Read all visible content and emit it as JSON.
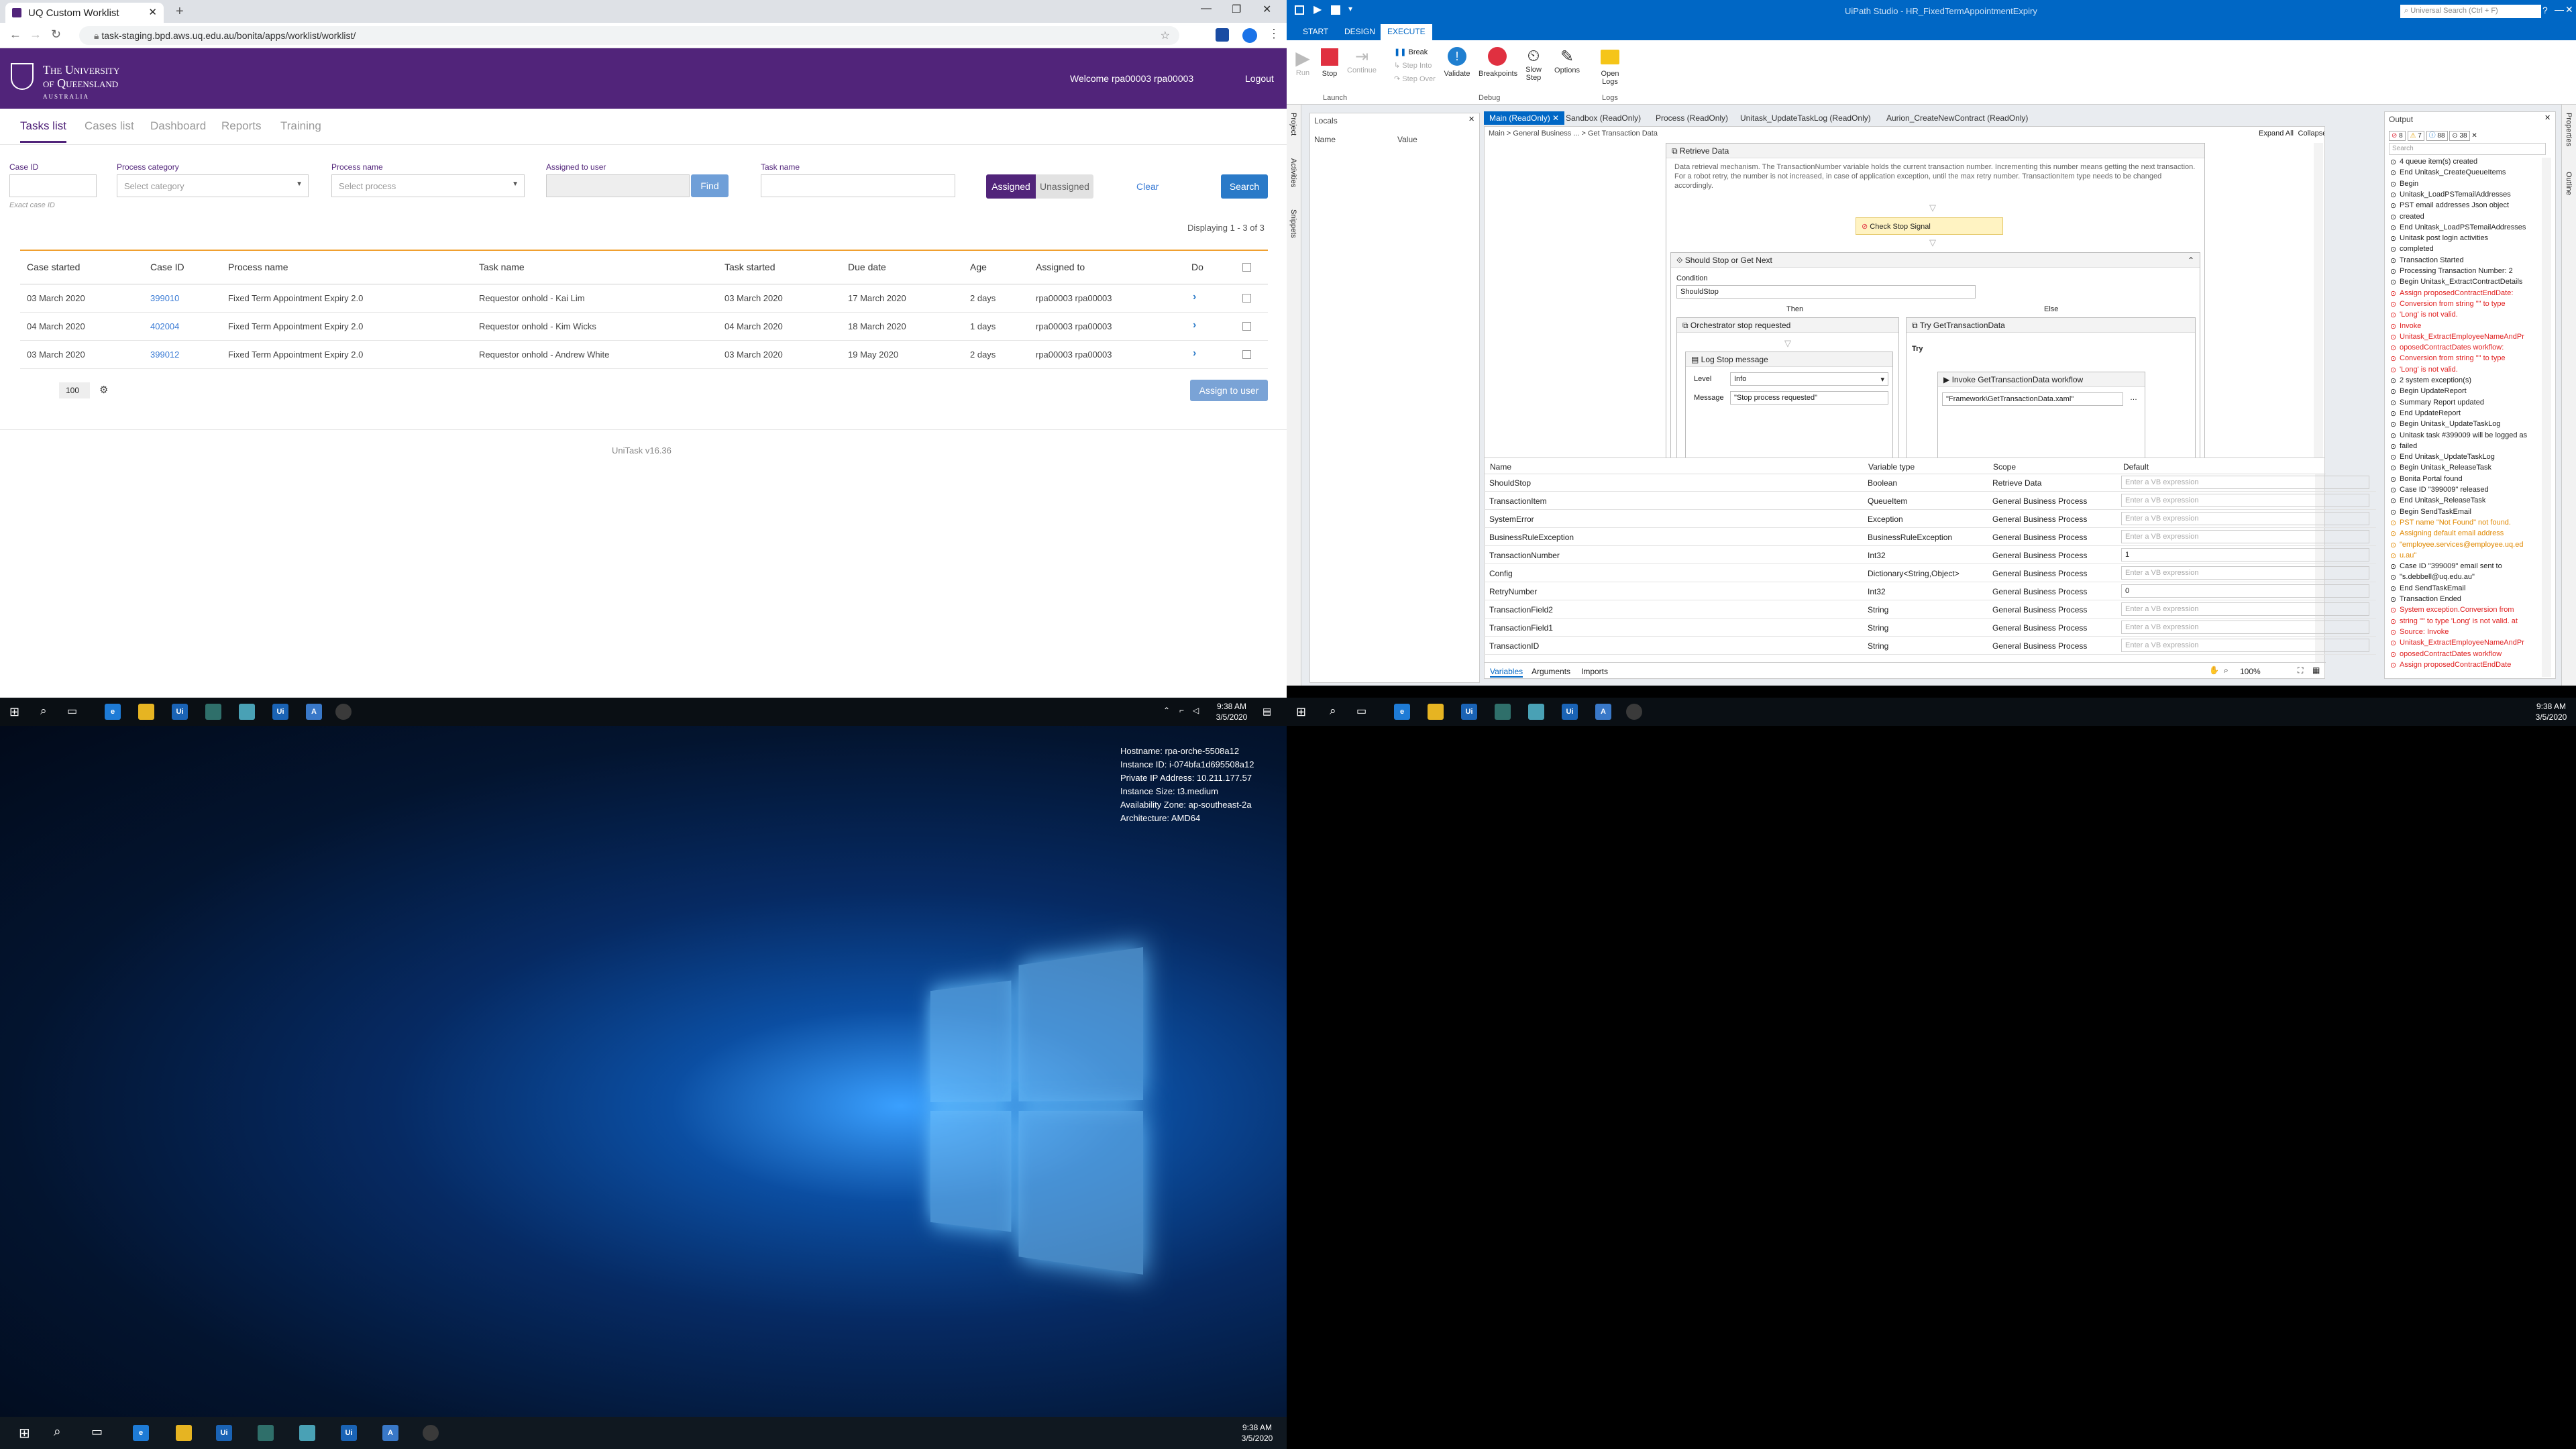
{
  "browser": {
    "tab_title": "UQ Custom Worklist",
    "url": "task-staging.bpd.aws.uq.edu.au/bonita/apps/worklist/worklist/"
  },
  "uq": {
    "logo_line1": "The University",
    "logo_line2": "of Queensland",
    "logo_line3": "AUSTRALIA",
    "welcome": "Welcome rpa00003 rpa00003",
    "logout": "Logout",
    "nav": [
      "Tasks list",
      "Cases list",
      "Dashboard",
      "Reports",
      "Training"
    ],
    "filters": {
      "case_id_label": "Case ID",
      "case_id_hint": "Exact case ID",
      "category_label": "Process category",
      "category_placeholder": "Select category",
      "process_label": "Process name",
      "process_placeholder": "Select process",
      "assigned_label": "Assigned to user",
      "find": "Find",
      "task_label": "Task name",
      "assigned": "Assigned",
      "unassigned": "Unassigned",
      "clear": "Clear",
      "search": "Search"
    },
    "displaying": "Displaying 1 - 3 of 3",
    "columns": [
      "Case started",
      "Case ID",
      "Process name",
      "Task name",
      "Task started",
      "Due date",
      "Age",
      "Assigned to",
      "Do"
    ],
    "rows": [
      {
        "case_started": "03 March 2020",
        "case_id": "399010",
        "process": "Fixed Term Appointment Expiry 2.0",
        "task": "Requestor onhold - Kai Lim",
        "task_started": "03 March 2020",
        "due": "17 March 2020",
        "age": "2 days",
        "assigned": "rpa00003 rpa00003"
      },
      {
        "case_started": "04 March 2020",
        "case_id": "402004",
        "process": "Fixed Term Appointment Expiry 2.0",
        "task": "Requestor onhold - Kim Wicks",
        "task_started": "04 March 2020",
        "due": "18 March 2020",
        "age": "1 days",
        "assigned": "rpa00003 rpa00003"
      },
      {
        "case_started": "03 March 2020",
        "case_id": "399012",
        "process": "Fixed Term Appointment Expiry 2.0",
        "task": "Requestor onhold - Andrew White",
        "task_started": "03 March 2020",
        "due": "19 May 2020",
        "age": "2 days",
        "assigned": "rpa00003 rpa00003"
      }
    ],
    "page_size": "100",
    "assign_btn": "Assign to user",
    "footer": "UniTask v16.36",
    "accent": "#51247a"
  },
  "uipath": {
    "title": "UiPath Studio - HR_FixedTermAppointmentExpiry",
    "search_placeholder": "Universal Search (Ctrl + F)",
    "ribbon_tabs": [
      "START",
      "DESIGN",
      "EXECUTE"
    ],
    "ribbon_buttons": [
      "Run",
      "Stop",
      "Continue",
      "Validate",
      "Breakpoints",
      "Slow Step",
      "Options",
      "Open Logs"
    ],
    "step_buttons": [
      "Break",
      "Step Into",
      "Step Over"
    ],
    "groups": [
      "Launch",
      "Debug",
      "Logs"
    ],
    "left_rail": [
      "Project",
      "Activities",
      "Snippets"
    ],
    "right_rail": [
      "Properties",
      "Outline"
    ],
    "locals": {
      "title": "Locals",
      "name": "Name",
      "value": "Value"
    },
    "doc_tabs": [
      "Main (ReadOnly)",
      "Sandbox (ReadOnly)",
      "Process (ReadOnly)",
      "Unitask_UpdateTaskLog (ReadOnly)",
      "Aurion_CreateNewContract (ReadOnly)"
    ],
    "breadcrumb": [
      "Main",
      "General Business ...",
      "Get Transaction Data"
    ],
    "expand_all": "Expand All",
    "collapse_all": "Collapse All",
    "designer": {
      "retrieve_data": "Retrieve Data",
      "retrieve_desc": "Data retrieval mechanism. The TransactionNumber variable holds the current transaction number. Incrementing this number means getting the next transaction. For a robot retry, the number is not increased, in case of application exception, until the max retry number. TransactionItem type needs to be changed accordingly.",
      "check_stop": "Check Stop Signal",
      "should_stop": "Should Stop or Get Next",
      "condition": "Condition",
      "condition_value": "ShouldStop",
      "then": "Then",
      "else": "Else",
      "orch_stop": "Orchestrator stop requested",
      "try_get": "Try GetTransactionData",
      "try": "Try",
      "log_stop": "Log Stop message",
      "level": "Level",
      "level_value": "Info",
      "message": "Message",
      "message_value": "\"Stop process requested\"",
      "invoke": "Invoke GetTransactionData workflow",
      "invoke_path": "\"Framework\\GetTransactionData.xaml\""
    },
    "variables": {
      "headers": [
        "Name",
        "Variable type",
        "Scope",
        "Default"
      ],
      "default_placeholder": "Enter a VB expression",
      "rows": [
        {
          "name": "ShouldStop",
          "type": "Boolean",
          "scope": "Retrieve Data",
          "default": ""
        },
        {
          "name": "TransactionItem",
          "type": "QueueItem",
          "scope": "General Business Process",
          "default": ""
        },
        {
          "name": "SystemError",
          "type": "Exception",
          "scope": "General Business Process",
          "default": ""
        },
        {
          "name": "BusinessRuleException",
          "type": "BusinessRuleException",
          "scope": "General Business Process",
          "default": ""
        },
        {
          "name": "TransactionNumber",
          "type": "Int32",
          "scope": "General Business Process",
          "default": "1"
        },
        {
          "name": "Config",
          "type": "Dictionary<String,Object>",
          "scope": "General Business Process",
          "default": ""
        },
        {
          "name": "RetryNumber",
          "type": "Int32",
          "scope": "General Business Process",
          "default": "0"
        },
        {
          "name": "TransactionField2",
          "type": "String",
          "scope": "General Business Process",
          "default": ""
        },
        {
          "name": "TransactionField1",
          "type": "String",
          "scope": "General Business Process",
          "default": ""
        },
        {
          "name": "TransactionID",
          "type": "String",
          "scope": "General Business Process",
          "default": ""
        }
      ],
      "bottom_tabs": [
        "Variables",
        "Arguments",
        "Imports"
      ],
      "zoom": "100%"
    },
    "output": {
      "title": "Output",
      "counts": [
        "8",
        "7",
        "88",
        "38"
      ],
      "search_placeholder": "Search",
      "lines": [
        {
          "t": "4 queue item(s) created",
          "k": "n"
        },
        {
          "t": "End Unitask_CreateQueueItems",
          "k": "n"
        },
        {
          "t": "Begin",
          "k": "n"
        },
        {
          "t": "Unitask_LoadPSTemailAddresses",
          "k": "n"
        },
        {
          "t": "PST email addresses Json object",
          "k": "n"
        },
        {
          "t": "created",
          "k": "n"
        },
        {
          "t": "End Unitask_LoadPSTemailAddresses",
          "k": "n"
        },
        {
          "t": "Unitask post login activities",
          "k": "n"
        },
        {
          "t": "completed",
          "k": "n"
        },
        {
          "t": "Transaction Started",
          "k": "n"
        },
        {
          "t": "Processing Transaction Number: 2",
          "k": "n"
        },
        {
          "t": "Begin Unitask_ExtractContractDetails",
          "k": "n"
        },
        {
          "t": "Assign proposedContractEndDate:",
          "k": "e"
        },
        {
          "t": "Conversion from string \"\" to type",
          "k": "e"
        },
        {
          "t": "'Long' is not valid.",
          "k": "e"
        },
        {
          "t": "Invoke",
          "k": "e"
        },
        {
          "t": "Unitask_ExtractEmployeeNameAndPr",
          "k": "e"
        },
        {
          "t": "oposedContractDates workflow:",
          "k": "e"
        },
        {
          "t": "Conversion from string \"\" to type",
          "k": "e"
        },
        {
          "t": "'Long' is not valid.",
          "k": "e"
        },
        {
          "t": "2 system exception(s)",
          "k": "n"
        },
        {
          "t": "Begin UpdateReport",
          "k": "n"
        },
        {
          "t": "Summary Report updated",
          "k": "n"
        },
        {
          "t": "End UpdateReport",
          "k": "n"
        },
        {
          "t": "Begin Unitask_UpdateTaskLog",
          "k": "n"
        },
        {
          "t": "Unitask task #399009 will be logged as",
          "k": "n"
        },
        {
          "t": "failed",
          "k": "n"
        },
        {
          "t": "End Unitask_UpdateTaskLog",
          "k": "n"
        },
        {
          "t": "Begin Unitask_ReleaseTask",
          "k": "n"
        },
        {
          "t": "Bonita Portal found",
          "k": "n"
        },
        {
          "t": "Case ID \"399009\" released",
          "k": "n"
        },
        {
          "t": "End Unitask_ReleaseTask",
          "k": "n"
        },
        {
          "t": "Begin SendTaskEmail",
          "k": "n"
        },
        {
          "t": "PST name \"Not Found\" not found.",
          "k": "w"
        },
        {
          "t": "Assigning default email address",
          "k": "w"
        },
        {
          "t": "\"employee.services@employee.uq.ed",
          "k": "w"
        },
        {
          "t": "u.au\"",
          "k": "w"
        },
        {
          "t": "Case ID \"399009\" email sent to",
          "k": "n"
        },
        {
          "t": "\"s.debbell@uq.edu.au\"",
          "k": "n"
        },
        {
          "t": "End SendTaskEmail",
          "k": "n"
        },
        {
          "t": "Transaction Ended",
          "k": "n"
        },
        {
          "t": "System exception.Conversion from",
          "k": "e"
        },
        {
          "t": "string \"\" to type 'Long' is not valid. at",
          "k": "e"
        },
        {
          "t": "Source: Invoke",
          "k": "e"
        },
        {
          "t": "Unitask_ExtractEmployeeNameAndPr",
          "k": "e"
        },
        {
          "t": "oposedContractDates workflow",
          "k": "e"
        },
        {
          "t": "Assign proposedContractEndDate",
          "k": "e"
        }
      ]
    },
    "accent": "#0067c5"
  },
  "taskbar_top": {
    "time": "9:38 AM",
    "date": "3/5/2020"
  },
  "taskbar_top_right": {
    "time": "9:38 AM",
    "date": "3/5/2020"
  },
  "taskbar_bottom": {
    "time": "9:38 AM",
    "date": "3/5/2020"
  },
  "bginfo": {
    "hostname": "Hostname: rpa-orche-5508a12",
    "instance_id": "Instance ID: i-074bfa1d695508a12",
    "private_ip": "Private IP Address: 10.211.177.57",
    "size": "Instance Size: t3.medium",
    "zone": "Availability Zone: ap-southeast-2a",
    "arch": "Architecture: AMD64"
  }
}
